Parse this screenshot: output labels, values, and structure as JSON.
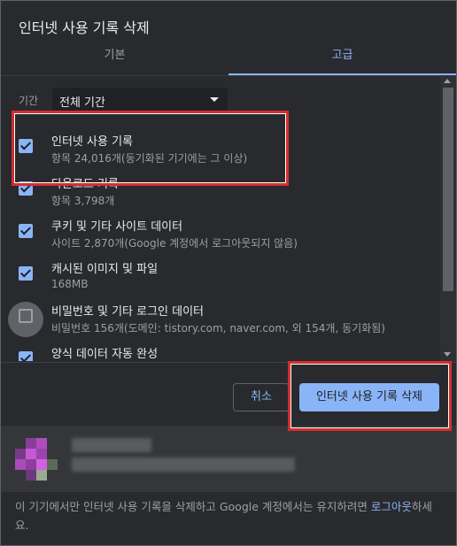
{
  "dialog": {
    "title": "인터넷 사용 기록 삭제"
  },
  "tabs": [
    {
      "label": "기본"
    },
    {
      "label": "고급"
    }
  ],
  "time_range": {
    "label": "기간",
    "value": "전체 기간"
  },
  "items": [
    {
      "title": "인터넷 사용 기록",
      "desc": "항목 24,016개(동기화된 기기에는 그 이상)",
      "checked": true
    },
    {
      "title": "다운로드 기록",
      "desc": "항목 3,798개",
      "checked": true
    },
    {
      "title": "쿠키 및 기타 사이트 데이터",
      "desc": "사이트 2,870개(Google 계정에서 로그아웃되지 않음)",
      "checked": true
    },
    {
      "title": "캐시된 이미지 및 파일",
      "desc": "168MB",
      "checked": true
    },
    {
      "title": "비밀번호 및 기타 로그인 데이터",
      "desc": "비밀번호 156개(도메인: tistory.com, naver.com, 외 154개, 동기화됨)",
      "checked": false
    },
    {
      "title": "양식 데이터 자동 완성",
      "desc": "",
      "checked": true
    }
  ],
  "buttons": {
    "cancel": "취소",
    "delete": "인터넷 사용 기록 삭제"
  },
  "footer_note": {
    "text": "이 기기에서만 인터넷 사용 기록을 삭제하고 Google 계정에서는 유지하려면 ",
    "link": "로그아웃",
    "suffix": "하세요."
  },
  "colors": {
    "accent": "#8ab4f8",
    "background": "#292a2d",
    "highlight": "#d32f2f"
  }
}
